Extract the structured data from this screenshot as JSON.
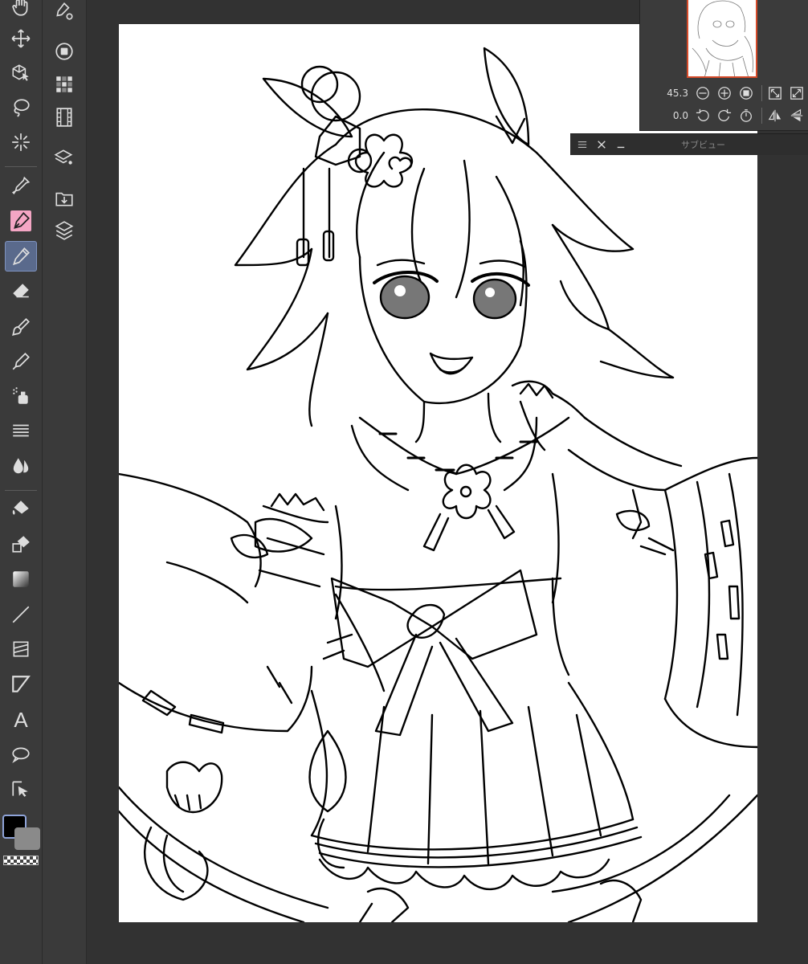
{
  "toolbar": {
    "tools": [
      {
        "id": "hand",
        "icon": "hand-icon"
      },
      {
        "id": "move",
        "icon": "move-icon"
      },
      {
        "id": "object",
        "icon": "object-select-icon"
      },
      {
        "id": "lasso",
        "icon": "lasso-select-icon"
      },
      {
        "id": "auto-select",
        "icon": "magic-wand-icon"
      },
      {
        "id": "eyedropper",
        "icon": "eyedropper-icon"
      },
      {
        "id": "pen",
        "icon": "pen-icon"
      },
      {
        "id": "pencil",
        "icon": "pencil-icon"
      },
      {
        "id": "eraser",
        "icon": "eraser-icon"
      },
      {
        "id": "brush",
        "icon": "brush-icon"
      },
      {
        "id": "decoration",
        "icon": "decoration-icon"
      },
      {
        "id": "airbrush",
        "icon": "airbrush-icon"
      },
      {
        "id": "hatching",
        "icon": "hatching-icon"
      },
      {
        "id": "blend",
        "icon": "blend-icon"
      },
      {
        "id": "fill",
        "icon": "fill-bucket-icon"
      },
      {
        "id": "fill-refer",
        "icon": "fill-refer-icon"
      },
      {
        "id": "gradient",
        "icon": "gradient-icon"
      },
      {
        "id": "line",
        "icon": "line-icon"
      },
      {
        "id": "frame",
        "icon": "frame-border-icon"
      },
      {
        "id": "ruler",
        "icon": "ruler-icon"
      },
      {
        "id": "text",
        "icon": "text-icon",
        "label": "A"
      },
      {
        "id": "balloon",
        "icon": "speech-balloon-icon"
      },
      {
        "id": "correct-line",
        "icon": "correct-line-icon"
      }
    ],
    "active_tool": "pencil",
    "colors": {
      "foreground": "#000000",
      "background": "#8a8a8a",
      "accent_active": "#5a6a8c",
      "accent_pink": "#f4a6c4"
    }
  },
  "sidecol": {
    "tools": [
      {
        "id": "tool-property",
        "icon": "tool-property-icon"
      },
      {
        "id": "color-circle",
        "icon": "color-circle-icon"
      },
      {
        "id": "color-set",
        "icon": "color-set-icon"
      },
      {
        "id": "animation",
        "icon": "film-icon"
      },
      {
        "id": "layer-property",
        "icon": "layer-property-icon"
      },
      {
        "id": "material",
        "icon": "material-download-icon"
      },
      {
        "id": "layers",
        "icon": "layers-icon"
      }
    ]
  },
  "navigator": {
    "zoom_value": "45.3",
    "rotation_value": "0.0",
    "accent": "#d64b2a"
  },
  "subview": {
    "title": "サブビュー"
  }
}
